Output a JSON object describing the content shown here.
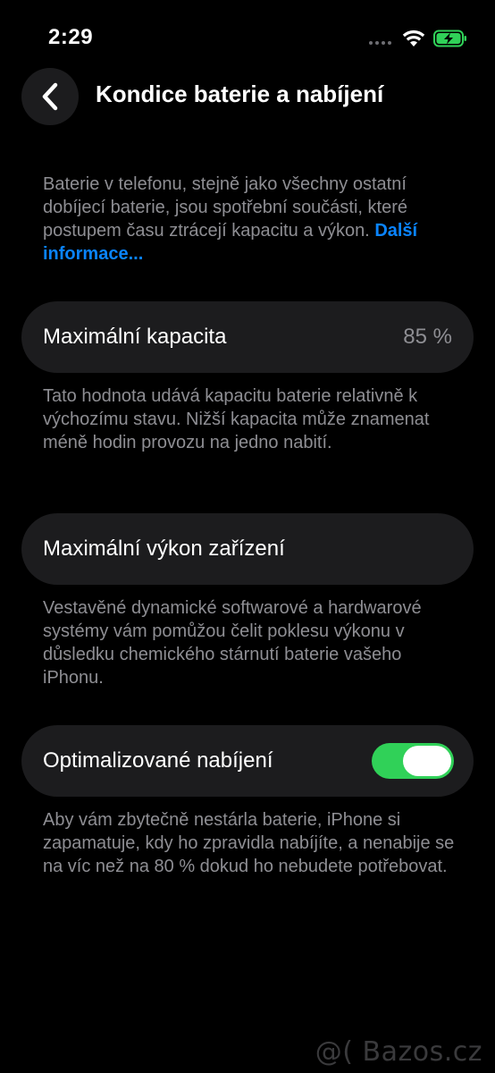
{
  "status_bar": {
    "time": "2:29"
  },
  "header": {
    "back_icon": "chevron-left-icon",
    "title": "Kondice baterie a nabíjení"
  },
  "intro": {
    "text": "Baterie v telefonu, stejně jako všechny ostatní dobíjecí baterie, jsou spotřební součásti, které postupem času ztrácejí kapacitu a výkon.",
    "link": "Další informace..."
  },
  "max_capacity": {
    "label": "Maximální kapacita",
    "value": "85 %",
    "description": "Tato hodnota udává kapacitu baterie relativně k výchozímu stavu. Nižší kapacita může znamenat méně hodin provozu na jedno nabití."
  },
  "peak_performance": {
    "label": "Maximální výkon zařízení",
    "description": "Vestavěné dynamické softwarové a hardwarové systémy vám pomůžou čelit poklesu výkonu v důsledku chemického stárnutí baterie vašeho iPhonu."
  },
  "optimized_charging": {
    "label": "Optimalizované nabíjení",
    "enabled": true,
    "description": "Aby vám zbytečně nestárla baterie, iPhone si zapamatuje, kdy ho zpravidla nabíjíte, a nenabije se na víc než na 80 % dokud ho nebudete potřebovat."
  },
  "watermark": "@( Bazos.cz",
  "colors": {
    "background": "#000000",
    "card": "#1c1c1e",
    "secondary_text": "#8e8e93",
    "link": "#0a84ff",
    "toggle_on": "#30d158",
    "battery_charging": "#30d158"
  }
}
